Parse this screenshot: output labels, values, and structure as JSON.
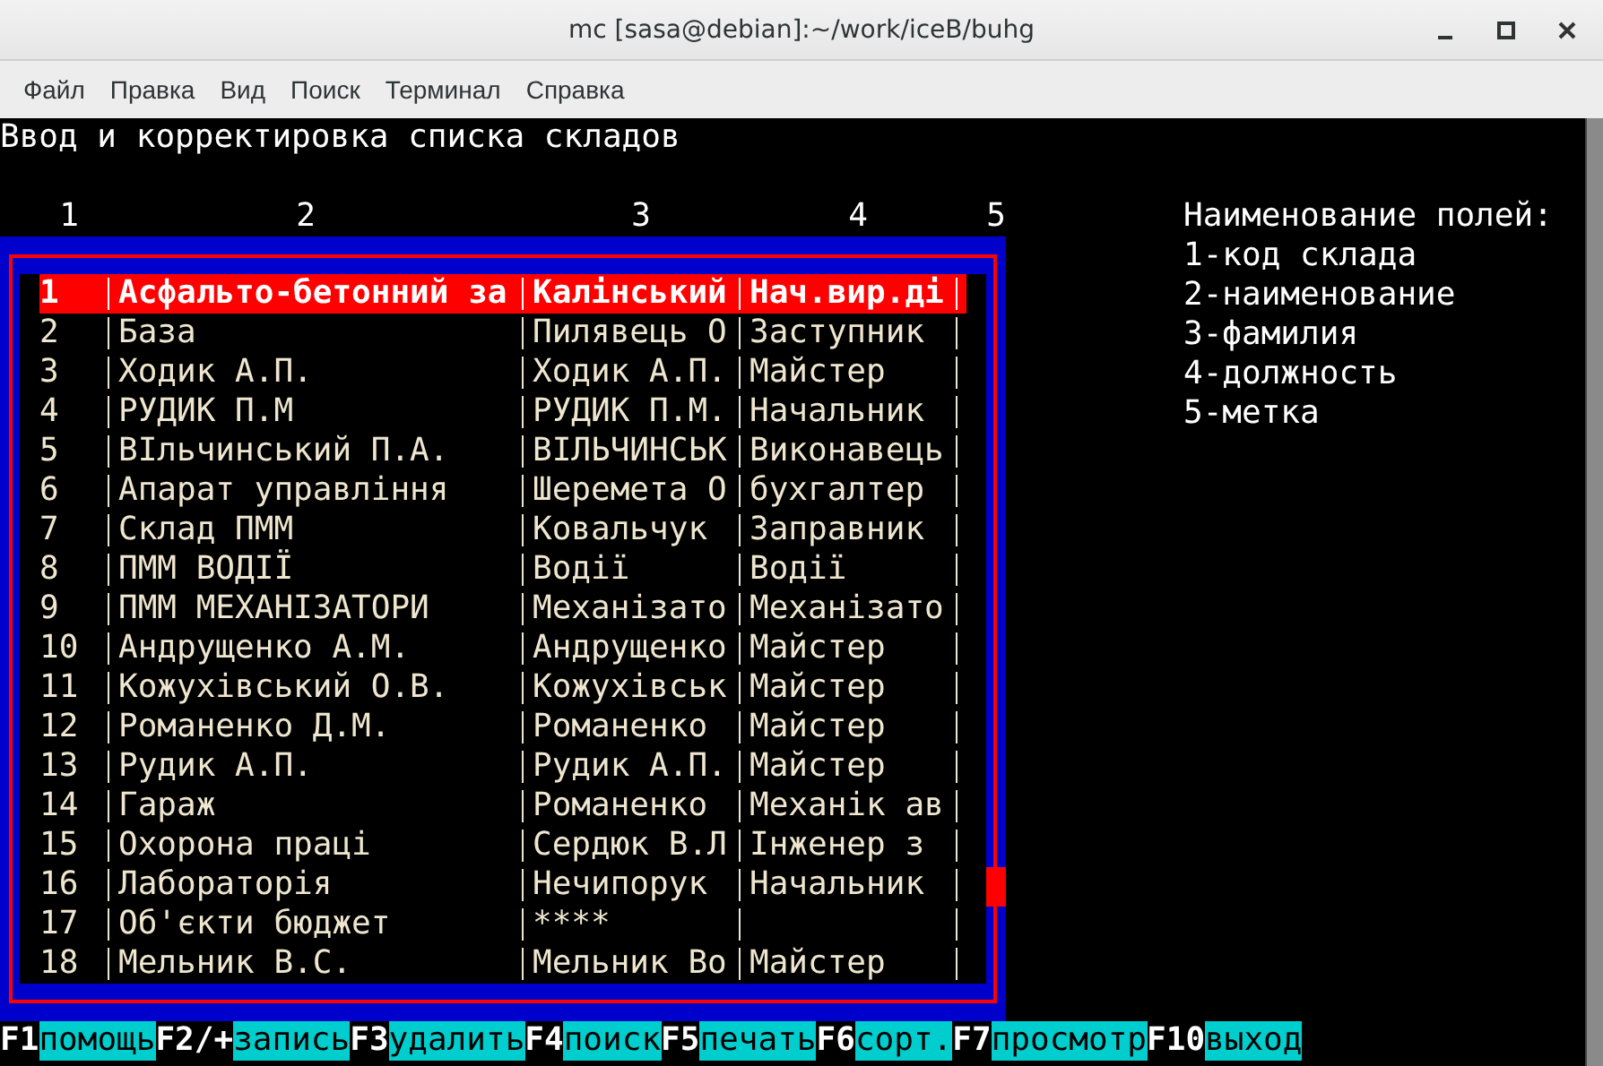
{
  "window": {
    "title": "mc [sasa@debian]:~/work/iceB/buhg"
  },
  "menu": [
    "Файл",
    "Правка",
    "Вид",
    "Поиск",
    "Терминал",
    "Справка"
  ],
  "screen": {
    "heading": "Ввод и корректировка списка складов",
    "column_numbers": [
      "1",
      "2",
      "3",
      "4",
      "5"
    ],
    "rows": [
      {
        "code": "1",
        "name": "Асфальто-бетонний за",
        "surname": "Калінський",
        "position": "Нач.вир.ді",
        "selected": true
      },
      {
        "code": "2",
        "name": "База",
        "surname": "Пилявець О",
        "position": "Заступник",
        "selected": false
      },
      {
        "code": "3",
        "name": "Ходик А.П.",
        "surname": "Ходик А.П.",
        "position": "Майстер",
        "selected": false
      },
      {
        "code": "4",
        "name": "РУДИК П.М",
        "surname": "РУДИК П.М.",
        "position": "Начальник",
        "selected": false
      },
      {
        "code": "5",
        "name": "ВІльчинський П.А.",
        "surname": "ВІЛЬЧИНСЬК",
        "position": "Виконавець",
        "selected": false
      },
      {
        "code": "6",
        "name": "Апарат управління",
        "surname": "Шеремета О",
        "position": "бухгалтер",
        "selected": false
      },
      {
        "code": "7",
        "name": "Склад ПММ",
        "surname": "Ковальчук",
        "position": "Заправник",
        "selected": false
      },
      {
        "code": "8",
        "name": "ПММ ВОДІЇ",
        "surname": "Водії",
        "position": "Водії",
        "selected": false
      },
      {
        "code": "9",
        "name": "ПММ МЕХАНІЗАТОРИ",
        "surname": "Механізато",
        "position": "Механізато",
        "selected": false
      },
      {
        "code": "10",
        "name": "Андрущенко А.М.",
        "surname": "Андрущенко",
        "position": "Майстер",
        "selected": false
      },
      {
        "code": "11",
        "name": "Кожухівський О.В.",
        "surname": "Кожухівськ",
        "position": "Майстер",
        "selected": false
      },
      {
        "code": "12",
        "name": "Романенко Д.М.",
        "surname": "Романенко",
        "position": "Майстер",
        "selected": false
      },
      {
        "code": "13",
        "name": "Рудик А.П.",
        "surname": "Рудик А.П.",
        "position": "Майстер",
        "selected": false
      },
      {
        "code": "14",
        "name": "Гараж",
        "surname": "Романенко",
        "position": "Механік ав",
        "selected": false
      },
      {
        "code": "15",
        "name": "Охорона праці",
        "surname": "Сердюк В.Л",
        "position": "Інженер з",
        "selected": false
      },
      {
        "code": "16",
        "name": "Лабораторія",
        "surname": "Нечипорук",
        "position": "Начальник",
        "selected": false
      },
      {
        "code": "17",
        "name": "Об'єкти бюджет",
        "surname": "****",
        "selected": false
      },
      {
        "code": "18",
        "name": "Мельник В.С.",
        "surname": "Мельник Во",
        "position": "Майстер",
        "selected": false
      }
    ],
    "legend": {
      "title": "Наименование полей:",
      "items": [
        "1-код склада",
        "2-наименование",
        "3-фамилия",
        "4-должность",
        "5-метка"
      ]
    }
  },
  "function_keys": [
    {
      "key": "F1",
      "label": "помощь"
    },
    {
      "key": "F2/+",
      "label": "запись"
    },
    {
      "key": "F3",
      "label": "удалить"
    },
    {
      "key": "F4",
      "label": "поиск"
    },
    {
      "key": "F5",
      "label": "печать"
    },
    {
      "key": "F6",
      "label": "сорт."
    },
    {
      "key": "F7",
      "label": "просмотр"
    },
    {
      "key": "F10",
      "label": "выход"
    }
  ]
}
